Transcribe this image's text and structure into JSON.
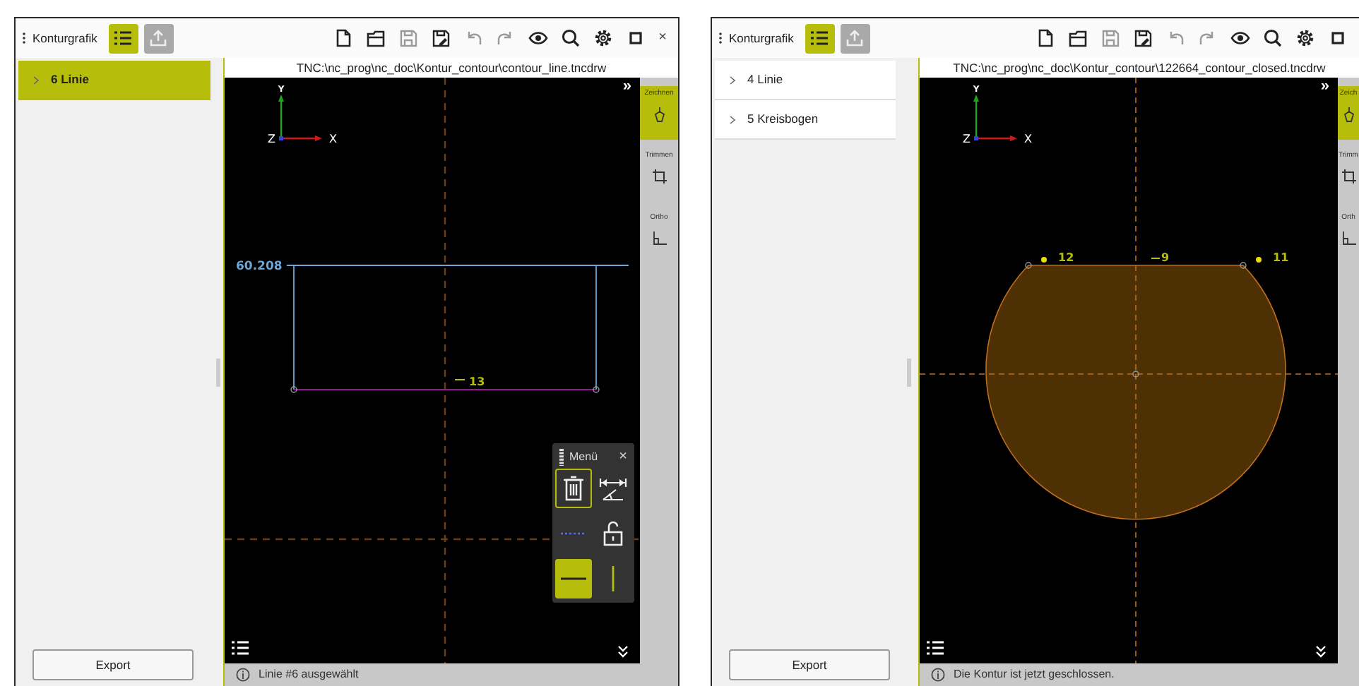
{
  "panels": [
    {
      "title": "Konturgrafik",
      "view_buttons": [
        {
          "kind": "list",
          "selected": true
        },
        {
          "kind": "export",
          "selected": false
        }
      ],
      "header_icons": [
        {
          "kind": "new",
          "disabled": false
        },
        {
          "kind": "open",
          "disabled": false
        },
        {
          "kind": "save",
          "disabled": true
        },
        {
          "kind": "save-as",
          "disabled": false
        },
        {
          "kind": "undo",
          "disabled": true
        },
        {
          "kind": "redo",
          "disabled": true
        },
        {
          "kind": "preview",
          "disabled": false
        },
        {
          "kind": "zoom",
          "disabled": false
        },
        {
          "kind": "settings",
          "disabled": false
        },
        {
          "kind": "maximize",
          "disabled": false
        }
      ],
      "close": "×",
      "elements": [
        {
          "label": "6 Linie",
          "selected": true
        }
      ],
      "export": "Export",
      "file_path": "TNC:\\nc_prog\\nc_doc\\Kontur_contour\\contour_line.tncdrw",
      "axes": {
        "y": "Y",
        "z": "Z",
        "x": "X"
      },
      "overflow": "»",
      "drawing": {
        "kind": "rectangle",
        "dimension": "60.208",
        "element_labels": [
          {
            "text": "13",
            "kind": "line"
          }
        ]
      },
      "tools": [
        {
          "kind": "draw",
          "label": "Zeichnen",
          "selected": true
        },
        {
          "kind": "trim",
          "label": "Trimmen",
          "selected": false
        },
        {
          "kind": "ortho",
          "label": "Ortho",
          "selected": false
        }
      ],
      "menu": {
        "title": "Menü",
        "close": "×",
        "tools": [
          {
            "kind": "delete",
            "selected": false,
            "focused": true
          },
          {
            "kind": "dimension",
            "selected": false,
            "focused": false
          },
          {
            "kind": "construction",
            "selected": false,
            "focused": false
          },
          {
            "kind": "unlock",
            "selected": false,
            "focused": false
          },
          {
            "kind": "horizontal",
            "selected": true,
            "focused": false
          },
          {
            "kind": "vertical",
            "selected": false,
            "focused": false
          }
        ]
      },
      "status": "Linie #6 ausgewählt"
    },
    {
      "title": "Konturgrafik",
      "view_buttons": [
        {
          "kind": "list",
          "selected": true
        },
        {
          "kind": "export",
          "selected": false
        }
      ],
      "header_icons": [
        {
          "kind": "new",
          "disabled": false
        },
        {
          "kind": "open",
          "disabled": false
        },
        {
          "kind": "save",
          "disabled": true
        },
        {
          "kind": "save-as",
          "disabled": false
        },
        {
          "kind": "undo",
          "disabled": true
        },
        {
          "kind": "redo",
          "disabled": true
        },
        {
          "kind": "preview",
          "disabled": false
        },
        {
          "kind": "zoom",
          "disabled": false
        },
        {
          "kind": "settings",
          "disabled": false
        },
        {
          "kind": "maximize",
          "disabled": false
        }
      ],
      "elements": [
        {
          "label": "4 Linie",
          "selected": false
        },
        {
          "label": "5 Kreisbogen",
          "selected": false
        }
      ],
      "export": "Export",
      "file_path": "TNC:\\nc_prog\\nc_doc\\Kontur_contour\\122664_contour_closed.tncdrw",
      "axes": {
        "y": "Y",
        "z": "Z",
        "x": "X"
      },
      "overflow": "»",
      "drawing": {
        "kind": "closed-contour",
        "element_labels": [
          {
            "text": "12",
            "kind": "point"
          },
          {
            "text": "9",
            "kind": "line"
          },
          {
            "text": "11",
            "kind": "point"
          }
        ]
      },
      "tools": [
        {
          "kind": "draw",
          "label": "Zeich",
          "selected": true
        },
        {
          "kind": "trim",
          "label": "Trimm",
          "selected": false
        },
        {
          "kind": "ortho",
          "label": "Orth",
          "selected": false
        }
      ],
      "status": "Die Kontur ist jetzt geschlossen."
    }
  ]
}
